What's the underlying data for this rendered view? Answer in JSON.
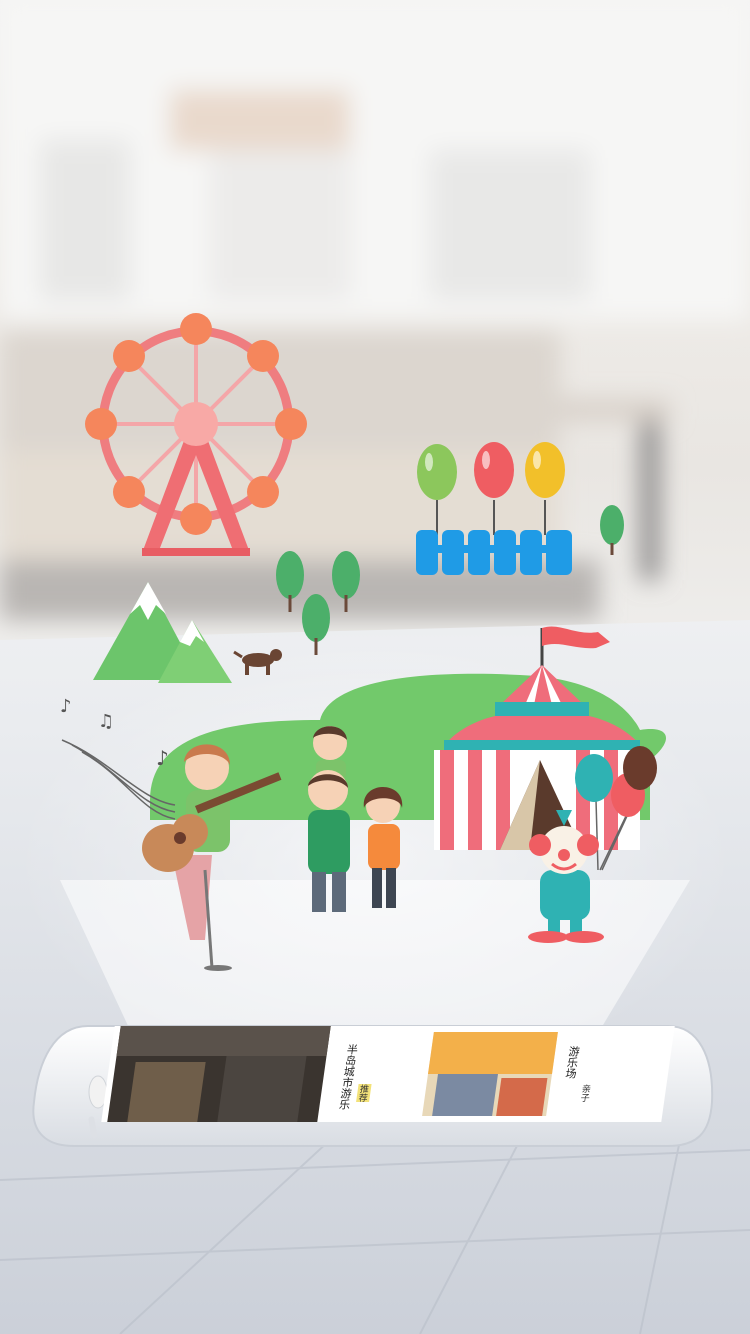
{
  "scene": {
    "colors": {
      "wheel": "#ef6e73",
      "wheel_pods": "#f5865c",
      "hills": "#6cc56b",
      "tent_red": "#ef6d7b",
      "tent_teal": "#2fb2b3",
      "fence": "#1f9be6",
      "balloons": [
        "#8cc75c",
        "#ef5d62",
        "#f2c02a"
      ]
    },
    "icons": [
      "ferris-wheel-icon",
      "mountain-icon",
      "tree-icon",
      "dog-icon",
      "balloon-icon",
      "fence-icon",
      "circus-tent-icon",
      "clown-icon",
      "music-note-icon",
      "guitar-icon",
      "family-icon",
      "phone-icon"
    ]
  },
  "phone": {
    "card1_title": "半岛城市游乐",
    "card1_tag": "推荐",
    "card2_title": "游乐场",
    "card2_tag": "亲子"
  }
}
